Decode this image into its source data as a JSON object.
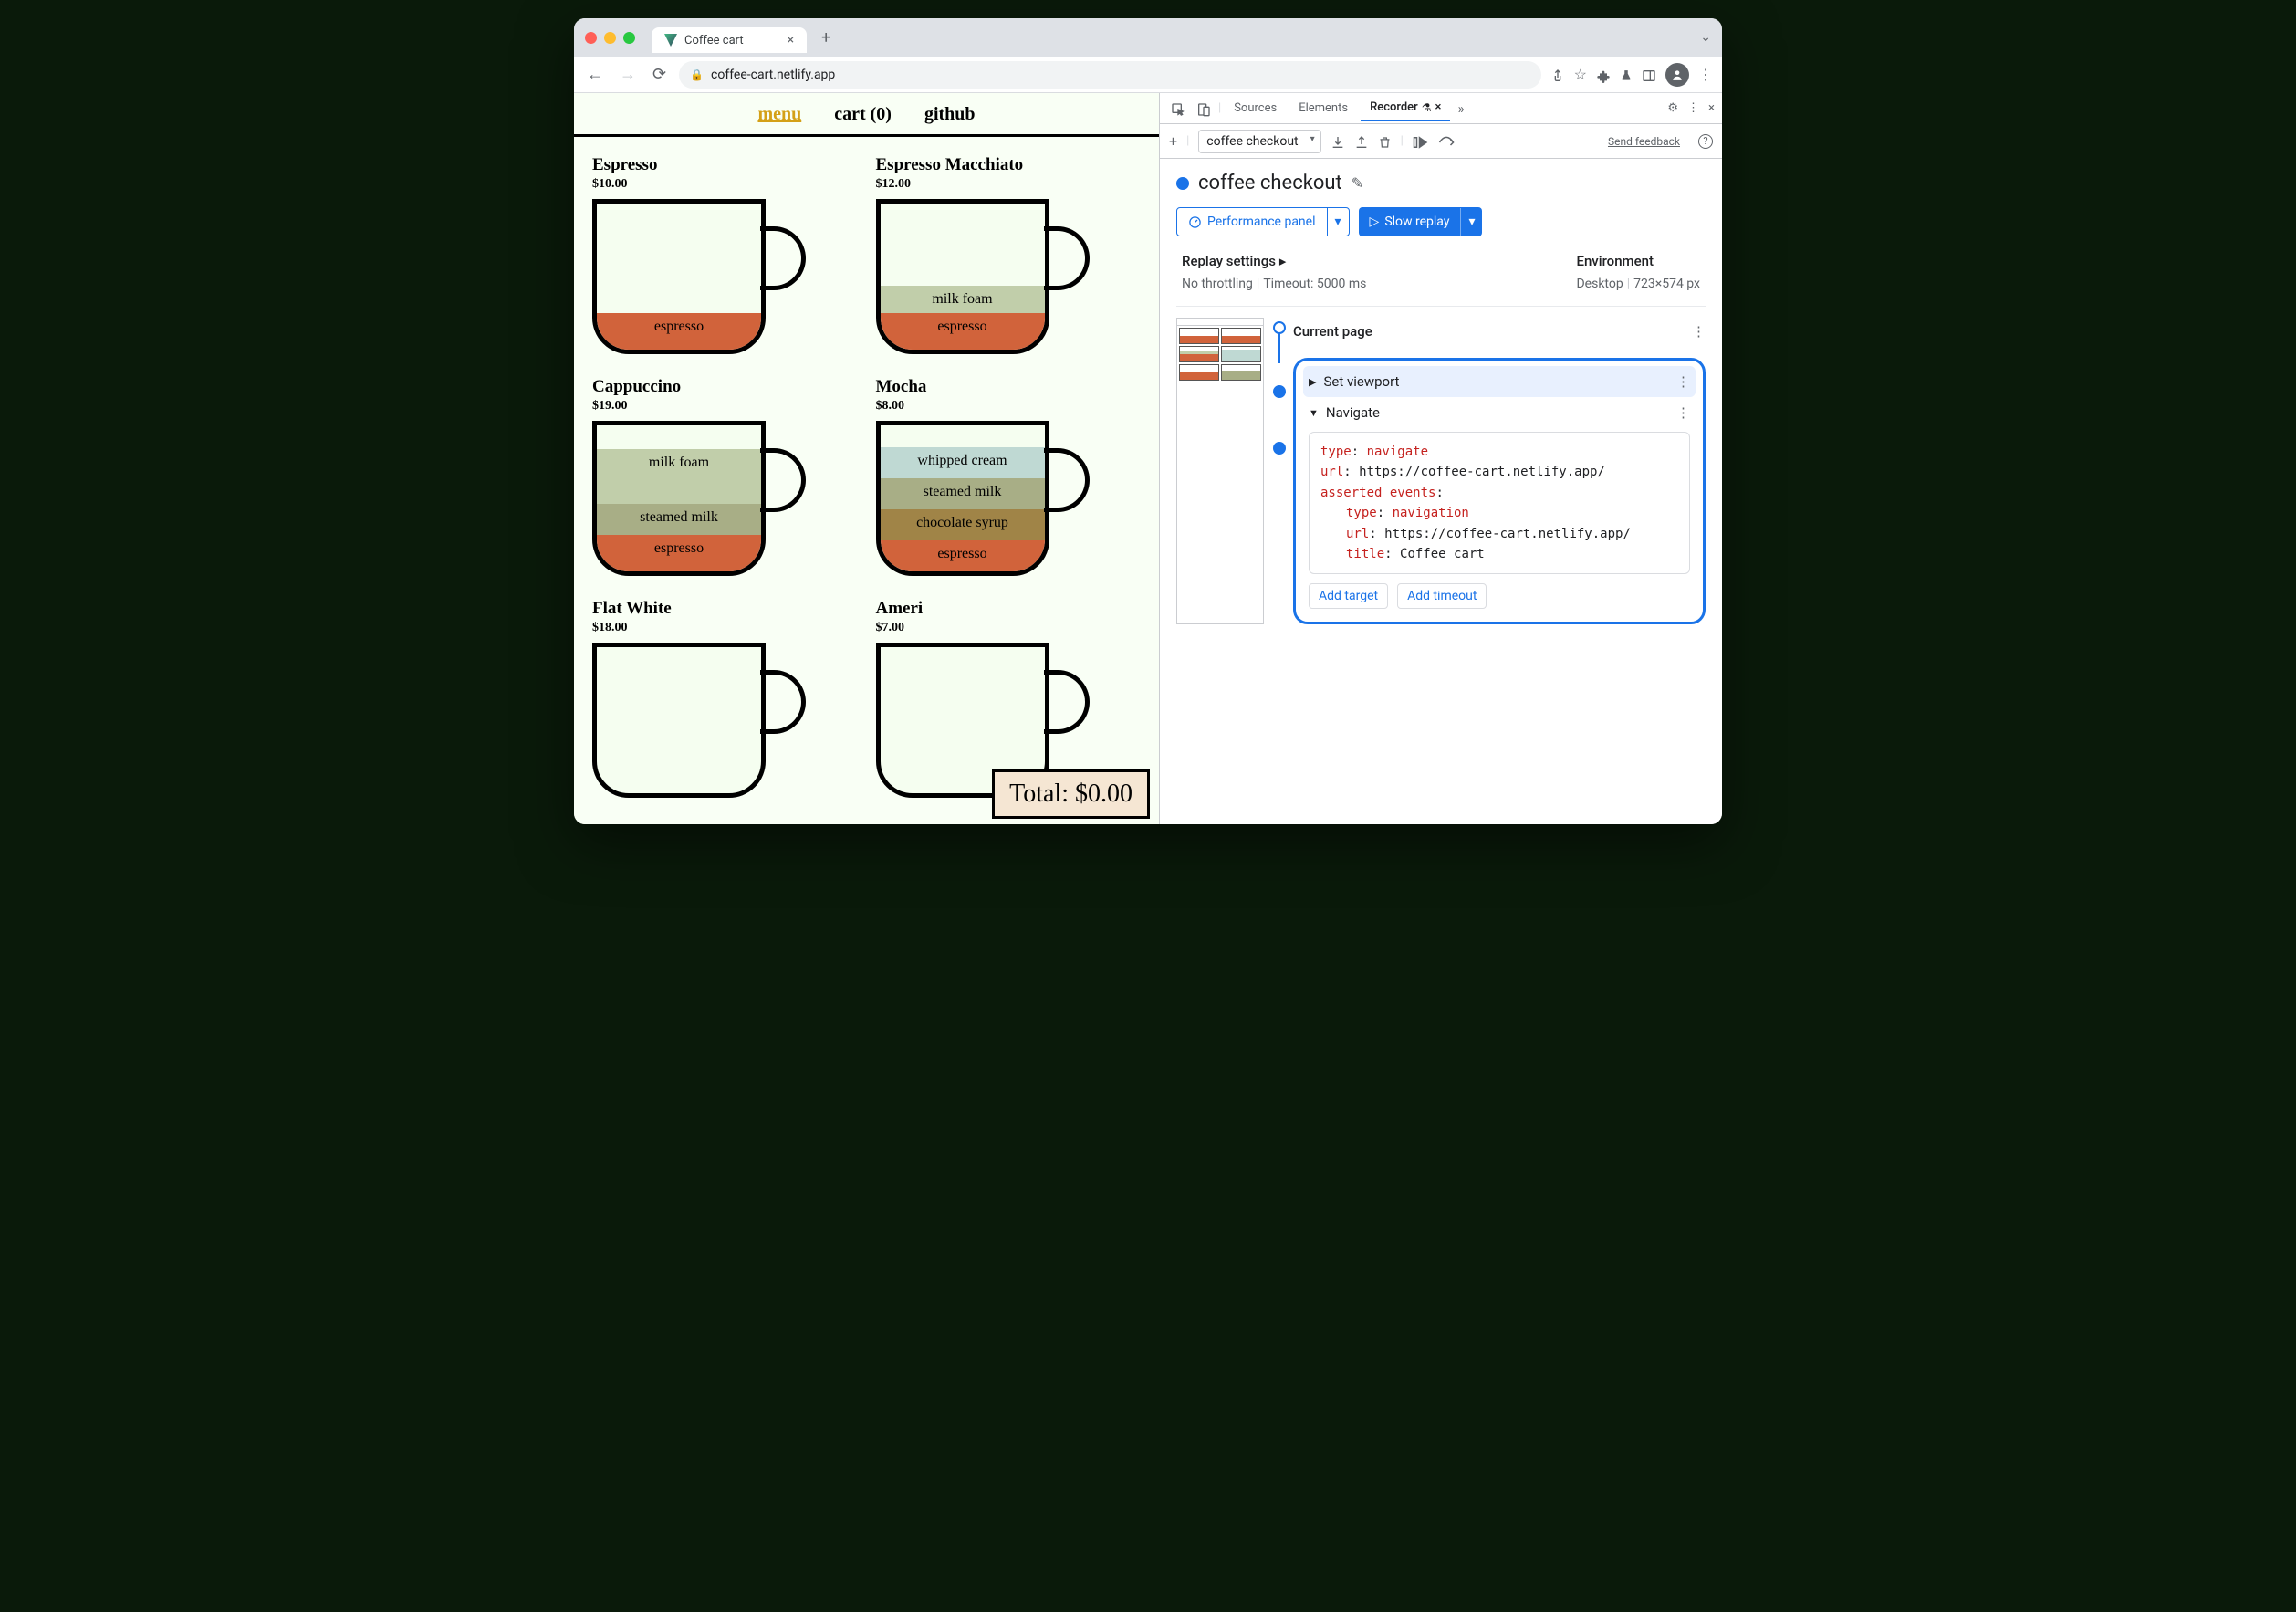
{
  "browser": {
    "tab_title": "Coffee cart",
    "url": "coffee-cart.netlify.app"
  },
  "nav": {
    "menu": "menu",
    "cart": "cart (0)",
    "github": "github"
  },
  "products": [
    {
      "name": "Espresso",
      "price": "$10.00",
      "layers": [
        {
          "label": "espresso",
          "cls": "l-esp",
          "h": 40
        }
      ]
    },
    {
      "name": "Espresso Macchiato",
      "price": "$12.00",
      "layers": [
        {
          "label": "milk foam",
          "cls": "l-foam",
          "h": 30
        },
        {
          "label": "espresso",
          "cls": "l-esp",
          "h": 40
        }
      ]
    },
    {
      "name": "Cappuccino",
      "price": "$19.00",
      "layers": [
        {
          "label": "milk foam",
          "cls": "l-foam",
          "h": 60
        },
        {
          "label": "steamed milk",
          "cls": "l-steam",
          "h": 34
        },
        {
          "label": "espresso",
          "cls": "l-esp",
          "h": 40
        }
      ]
    },
    {
      "name": "Mocha",
      "price": "$8.00",
      "layers": [
        {
          "label": "whipped cream",
          "cls": "l-whip",
          "h": 34
        },
        {
          "label": "steamed milk",
          "cls": "l-steam",
          "h": 34
        },
        {
          "label": "chocolate syrup",
          "cls": "l-choc",
          "h": 34
        },
        {
          "label": "espresso",
          "cls": "l-esp",
          "h": 34
        }
      ]
    },
    {
      "name": "Flat White",
      "price": "$18.00",
      "layers": []
    },
    {
      "name": "Ameri",
      "price": "$7.00",
      "layers": []
    }
  ],
  "total": "Total: $0.00",
  "devtools": {
    "tabs": {
      "sources": "Sources",
      "elements": "Elements",
      "recorder": "Recorder"
    },
    "toolbar": {
      "recording_name": "coffee checkout",
      "feedback": "Send feedback"
    },
    "recording_title": "coffee checkout",
    "perf_btn": "Performance panel",
    "replay_btn": "Slow replay",
    "replay_settings": {
      "title": "Replay settings",
      "throttle": "No throttling",
      "timeout": "Timeout: 5000 ms"
    },
    "environment": {
      "title": "Environment",
      "device": "Desktop",
      "viewport": "723×574 px"
    },
    "current_page": "Current page",
    "step1": "Set viewport",
    "step2": {
      "title": "Navigate",
      "type_k": "type",
      "type_v": "navigate",
      "url_k": "url",
      "url_v": "https://coffee-cart.netlify.app/",
      "assert_k": "asserted events",
      "ae_type_k": "type",
      "ae_type_v": "navigation",
      "ae_url_k": "url",
      "ae_url_v": "https://coffee-cart.netlify.app/",
      "ae_title_k": "title",
      "ae_title_v": "Coffee cart",
      "add_target": "Add target",
      "add_timeout": "Add timeout"
    }
  }
}
